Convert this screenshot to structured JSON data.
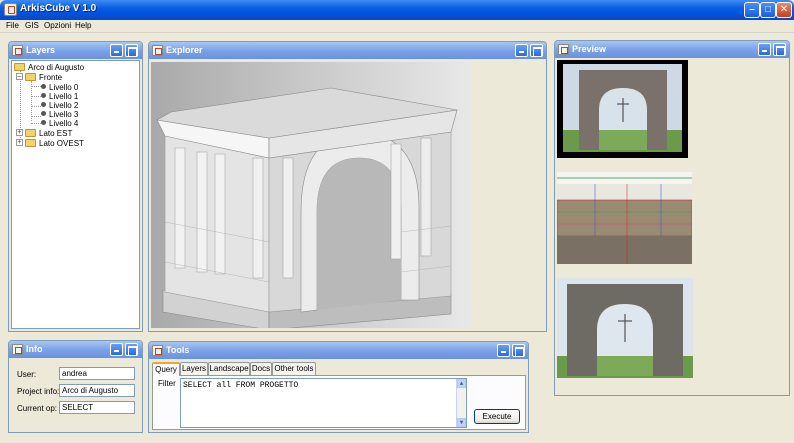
{
  "app": {
    "title": "ArkisCube V 1.0"
  },
  "menu": {
    "items": [
      "File",
      "GIS",
      "Opzioni",
      "Help"
    ]
  },
  "layers": {
    "title": "Layers",
    "root": "Arco di Augusto",
    "groups": [
      {
        "label": "Fronte",
        "expanded": true,
        "children": [
          "Livello 0",
          "Livello 1",
          "Livello 2",
          "Livello 3",
          "Livello 4"
        ]
      },
      {
        "label": "Lato EST",
        "expanded": false
      },
      {
        "label": "Lato OVEST",
        "expanded": false
      }
    ]
  },
  "explorer": {
    "title": "Explorer"
  },
  "preview": {
    "title": "Preview"
  },
  "info": {
    "title": "Info",
    "fields": [
      {
        "label": "User:",
        "value": "andrea"
      },
      {
        "label": "Project info:",
        "value": "Arco di Augusto"
      },
      {
        "label": "Current op:",
        "value": "SELECT"
      }
    ]
  },
  "tools": {
    "title": "Tools",
    "tabs": [
      "Query",
      "Layers",
      "Landscape",
      "Docs",
      "Other tools"
    ],
    "active_tab": "Query",
    "filter_label": "Filter",
    "query_text": "SELECT all FROM PROGETTO",
    "execute_label": "Execute"
  },
  "colors": {
    "titlebar": "#0055e5",
    "frame_title": "#7ba2e7",
    "background": "#ece9d8"
  },
  "icons": {
    "app": "app-icon",
    "folder": "folder-icon",
    "minimize": "minimize-icon",
    "maximize": "maximize-icon",
    "close": "close-icon"
  }
}
